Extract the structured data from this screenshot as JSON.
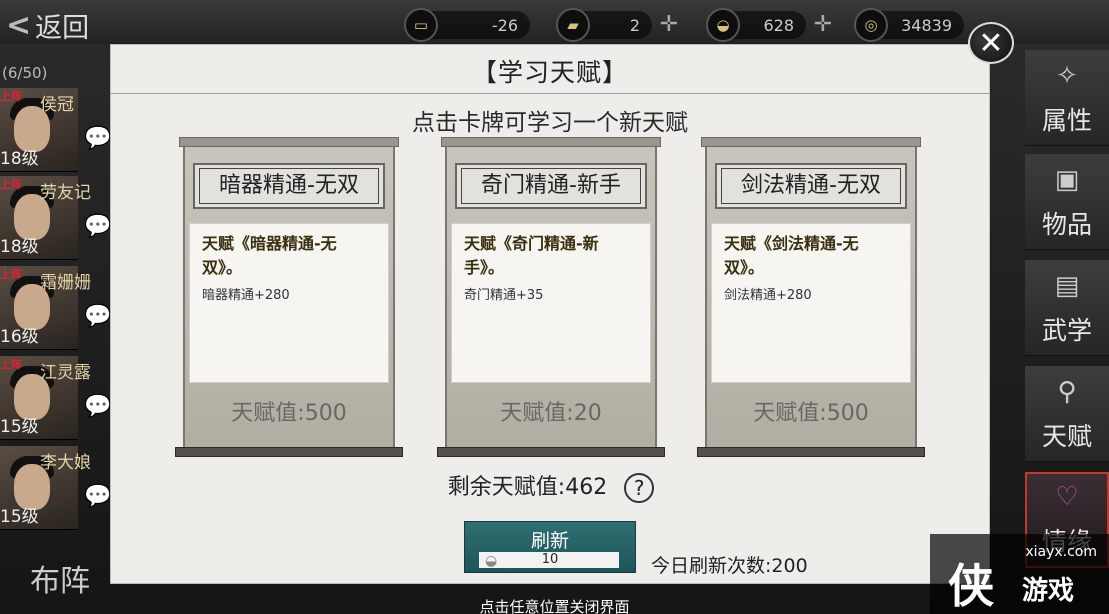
{
  "topbar": {
    "back_label": "返回",
    "resources": [
      {
        "icon": "scroll-icon",
        "value": "-26"
      },
      {
        "icon": "gold-bar-icon",
        "value": "2"
      },
      {
        "icon": "silver-ingot-icon",
        "value": "628"
      },
      {
        "icon": "coin-icon",
        "value": "34839"
      }
    ]
  },
  "roster": {
    "count": "(6/50)",
    "heroes": [
      {
        "name": "侯冠",
        "level": "18级",
        "tag": "上阵"
      },
      {
        "name": "劳友记",
        "level": "18级",
        "tag": "上阵"
      },
      {
        "name": "霜姗姗",
        "level": "16级",
        "tag": "上阵"
      },
      {
        "name": "江灵露",
        "level": "15级",
        "tag": "上阵"
      },
      {
        "name": "李大娘",
        "level": "15级",
        "tag": ""
      }
    ],
    "formation_label": "布阵"
  },
  "right_menu": {
    "items": [
      {
        "label": "属性",
        "icon": "bird-icon"
      },
      {
        "label": "物品",
        "icon": "box-icon"
      },
      {
        "label": "武学",
        "icon": "book-icon"
      },
      {
        "label": "天赋",
        "icon": "talent-icon"
      },
      {
        "label": "情缘",
        "icon": "heart-icon"
      }
    ]
  },
  "modal": {
    "title": "【学习天赋】",
    "subtitle": "点击卡牌可学习一个新天赋",
    "cards": [
      {
        "name": "暗器精通-无双",
        "desc": "天赋《暗器精通-无双》。",
        "effect": "暗器精通+280",
        "value_label": "天赋值:500"
      },
      {
        "name": "奇门精通-新手",
        "desc": "天赋《奇门精通-新手》。",
        "effect": "奇门精通+35",
        "value_label": "天赋值:20"
      },
      {
        "name": "剑法精通-无双",
        "desc": "天赋《剑法精通-无双》。",
        "effect": "剑法精通+280",
        "value_label": "天赋值:500"
      }
    ],
    "remaining_label": "剩余天赋值:462",
    "help_symbol": "?",
    "refresh": {
      "label": "刷新",
      "cost": "10"
    },
    "daily_refresh_label": "今日刷新次数:200"
  },
  "hint": "点击任意位置关闭界面",
  "watermark": {
    "site": "xiayx.com",
    "logo": "侠",
    "brand": "游戏"
  },
  "colors": {
    "accent_teal": "#2f6f73",
    "active_border": "#c0392b"
  }
}
